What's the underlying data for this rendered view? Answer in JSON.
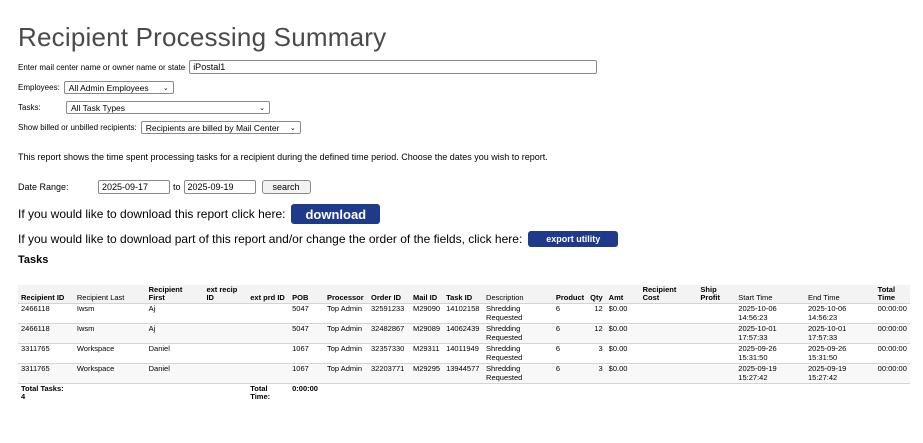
{
  "page_title": "Recipient Processing Summary",
  "filters": {
    "search_label": "Enter mail center name or owner name or state",
    "search_value": "iPostal1",
    "employees_label": "Employees:",
    "employees_value": "All Admin Employees",
    "tasks_label": "Tasks:",
    "tasks_value": "All Task Types",
    "billed_label": "Show billed or unbilled recipients:",
    "billed_value": "Recipients are billed by Mail Center"
  },
  "description": "This report shows the time spent processing tasks for a recipient during the defined time period. Choose the dates you wish to report.",
  "date_range": {
    "label": "Date Range:",
    "from": "2025-09-17",
    "to_label": "to",
    "to": "2025-09-19",
    "search_label": "search"
  },
  "download": {
    "text": "If you would like to download this report click here:",
    "button": "download",
    "partial_text": "If you would like to download part of this report and/or change the order of the fields, click here:",
    "export_button": "export utility"
  },
  "tasks_heading": "Tasks",
  "table": {
    "headers": [
      "Recipient ID",
      "Recipient Last",
      "Recipient First",
      "ext recip ID",
      "ext prd ID",
      "POB",
      "Processor",
      "Order ID",
      "Mail ID",
      "Task ID",
      "Description",
      "Product",
      "Qty",
      "Amt",
      "Recipient Cost",
      "Ship Profit",
      "Start Time",
      "End Time",
      "Total Time"
    ],
    "rows": [
      [
        "2466118",
        "Iwsm",
        "Aj",
        "",
        "",
        "5047",
        "Top Admin",
        "32591233",
        "M29090",
        "14102158",
        "Shredding Requested",
        "6",
        "12",
        "$0.00",
        "",
        "",
        "2025-10-06 14:56:23",
        "2025-10-06 14:56:23",
        "00:00:00"
      ],
      [
        "2466118",
        "Iwsm",
        "Aj",
        "",
        "",
        "5047",
        "Top Admin",
        "32482867",
        "M29089",
        "14062439",
        "Shredding Requested",
        "6",
        "12",
        "$0.00",
        "",
        "",
        "2025-10-01 17:57:33",
        "2025-10-01 17:57:33",
        "00:00:00"
      ],
      [
        "3311765",
        "Workspace",
        "Daniel",
        "",
        "",
        "1067",
        "Top Admin",
        "32357330",
        "M29311",
        "14011949",
        "Shredding Requested",
        "6",
        "3",
        "$0.00",
        "",
        "",
        "2025-09-26 15:31:50",
        "2025-09-26 15:31:50",
        "00:00:00"
      ],
      [
        "3311765",
        "Workspace",
        "Daniel",
        "",
        "",
        "1067",
        "Top Admin",
        "32203771",
        "M29295",
        "13944577",
        "Shredding Requested",
        "6",
        "3",
        "$0.00",
        "",
        "",
        "2025-09-19 15:27:42",
        "2025-09-19 15:27:42",
        "00:00:00"
      ]
    ],
    "footer": {
      "total_tasks_label": "Total Tasks:",
      "total_tasks": "4",
      "total_time_label": "Total Time:",
      "total_time": "0:00:00"
    }
  },
  "colors": {
    "button_blue": "#1f3a8a",
    "title_gray": "#4a4a4a"
  }
}
